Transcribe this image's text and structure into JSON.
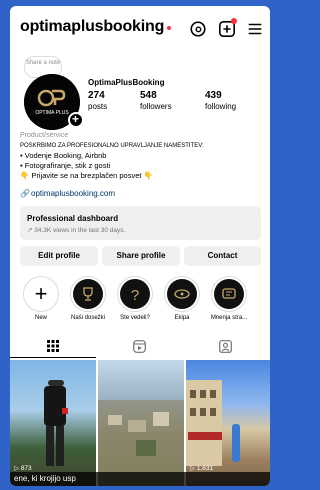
{
  "profile": {
    "username": "optimaplusbooking",
    "display_name": "OptimaPlusBooking",
    "note_placeholder": "Share a note",
    "posts_count": "274",
    "posts_label": "posts",
    "followers_count": "548",
    "followers_label": "followers",
    "following_count": "439",
    "following_label": "following",
    "category": "Product/service",
    "bio_lines": [
      "POSKRBIMO ZA PROFESIONALNO UPRAVLJANJE NAMESTITEV:",
      "▪ Vodenje Booking, Airbnb",
      "▪ Fotografiranje, stik z gosti",
      "👇 Prijavite se na brezplačen posvet 👇"
    ],
    "link": "optimaplusbooking.com",
    "avatar_brand": "OPTIMA PLUS"
  },
  "dashboard": {
    "title": "Professional dashboard",
    "subtitle": "34.3K views in the last 30 days."
  },
  "actions": {
    "edit": "Edit profile",
    "share": "Share profile",
    "contact": "Contact"
  },
  "highlights": [
    {
      "label": "New"
    },
    {
      "label": "Naši dosežki"
    },
    {
      "label": "Ste vedeli?"
    },
    {
      "label": "Ekipa"
    },
    {
      "label": "Mnenja stra..."
    }
  ],
  "grid": {
    "views": [
      "873",
      "",
      "1,631"
    ],
    "caption": "ene, ki krojijo usp"
  },
  "colors": {
    "background": "#2f63c8",
    "notification_red": "#ff3040",
    "link": "#00376b",
    "button_bg": "#efefef"
  },
  "icons": [
    "threads-icon",
    "create-icon",
    "menu-icon",
    "link-icon",
    "grid-icon",
    "reels-icon",
    "tagged-icon"
  ]
}
